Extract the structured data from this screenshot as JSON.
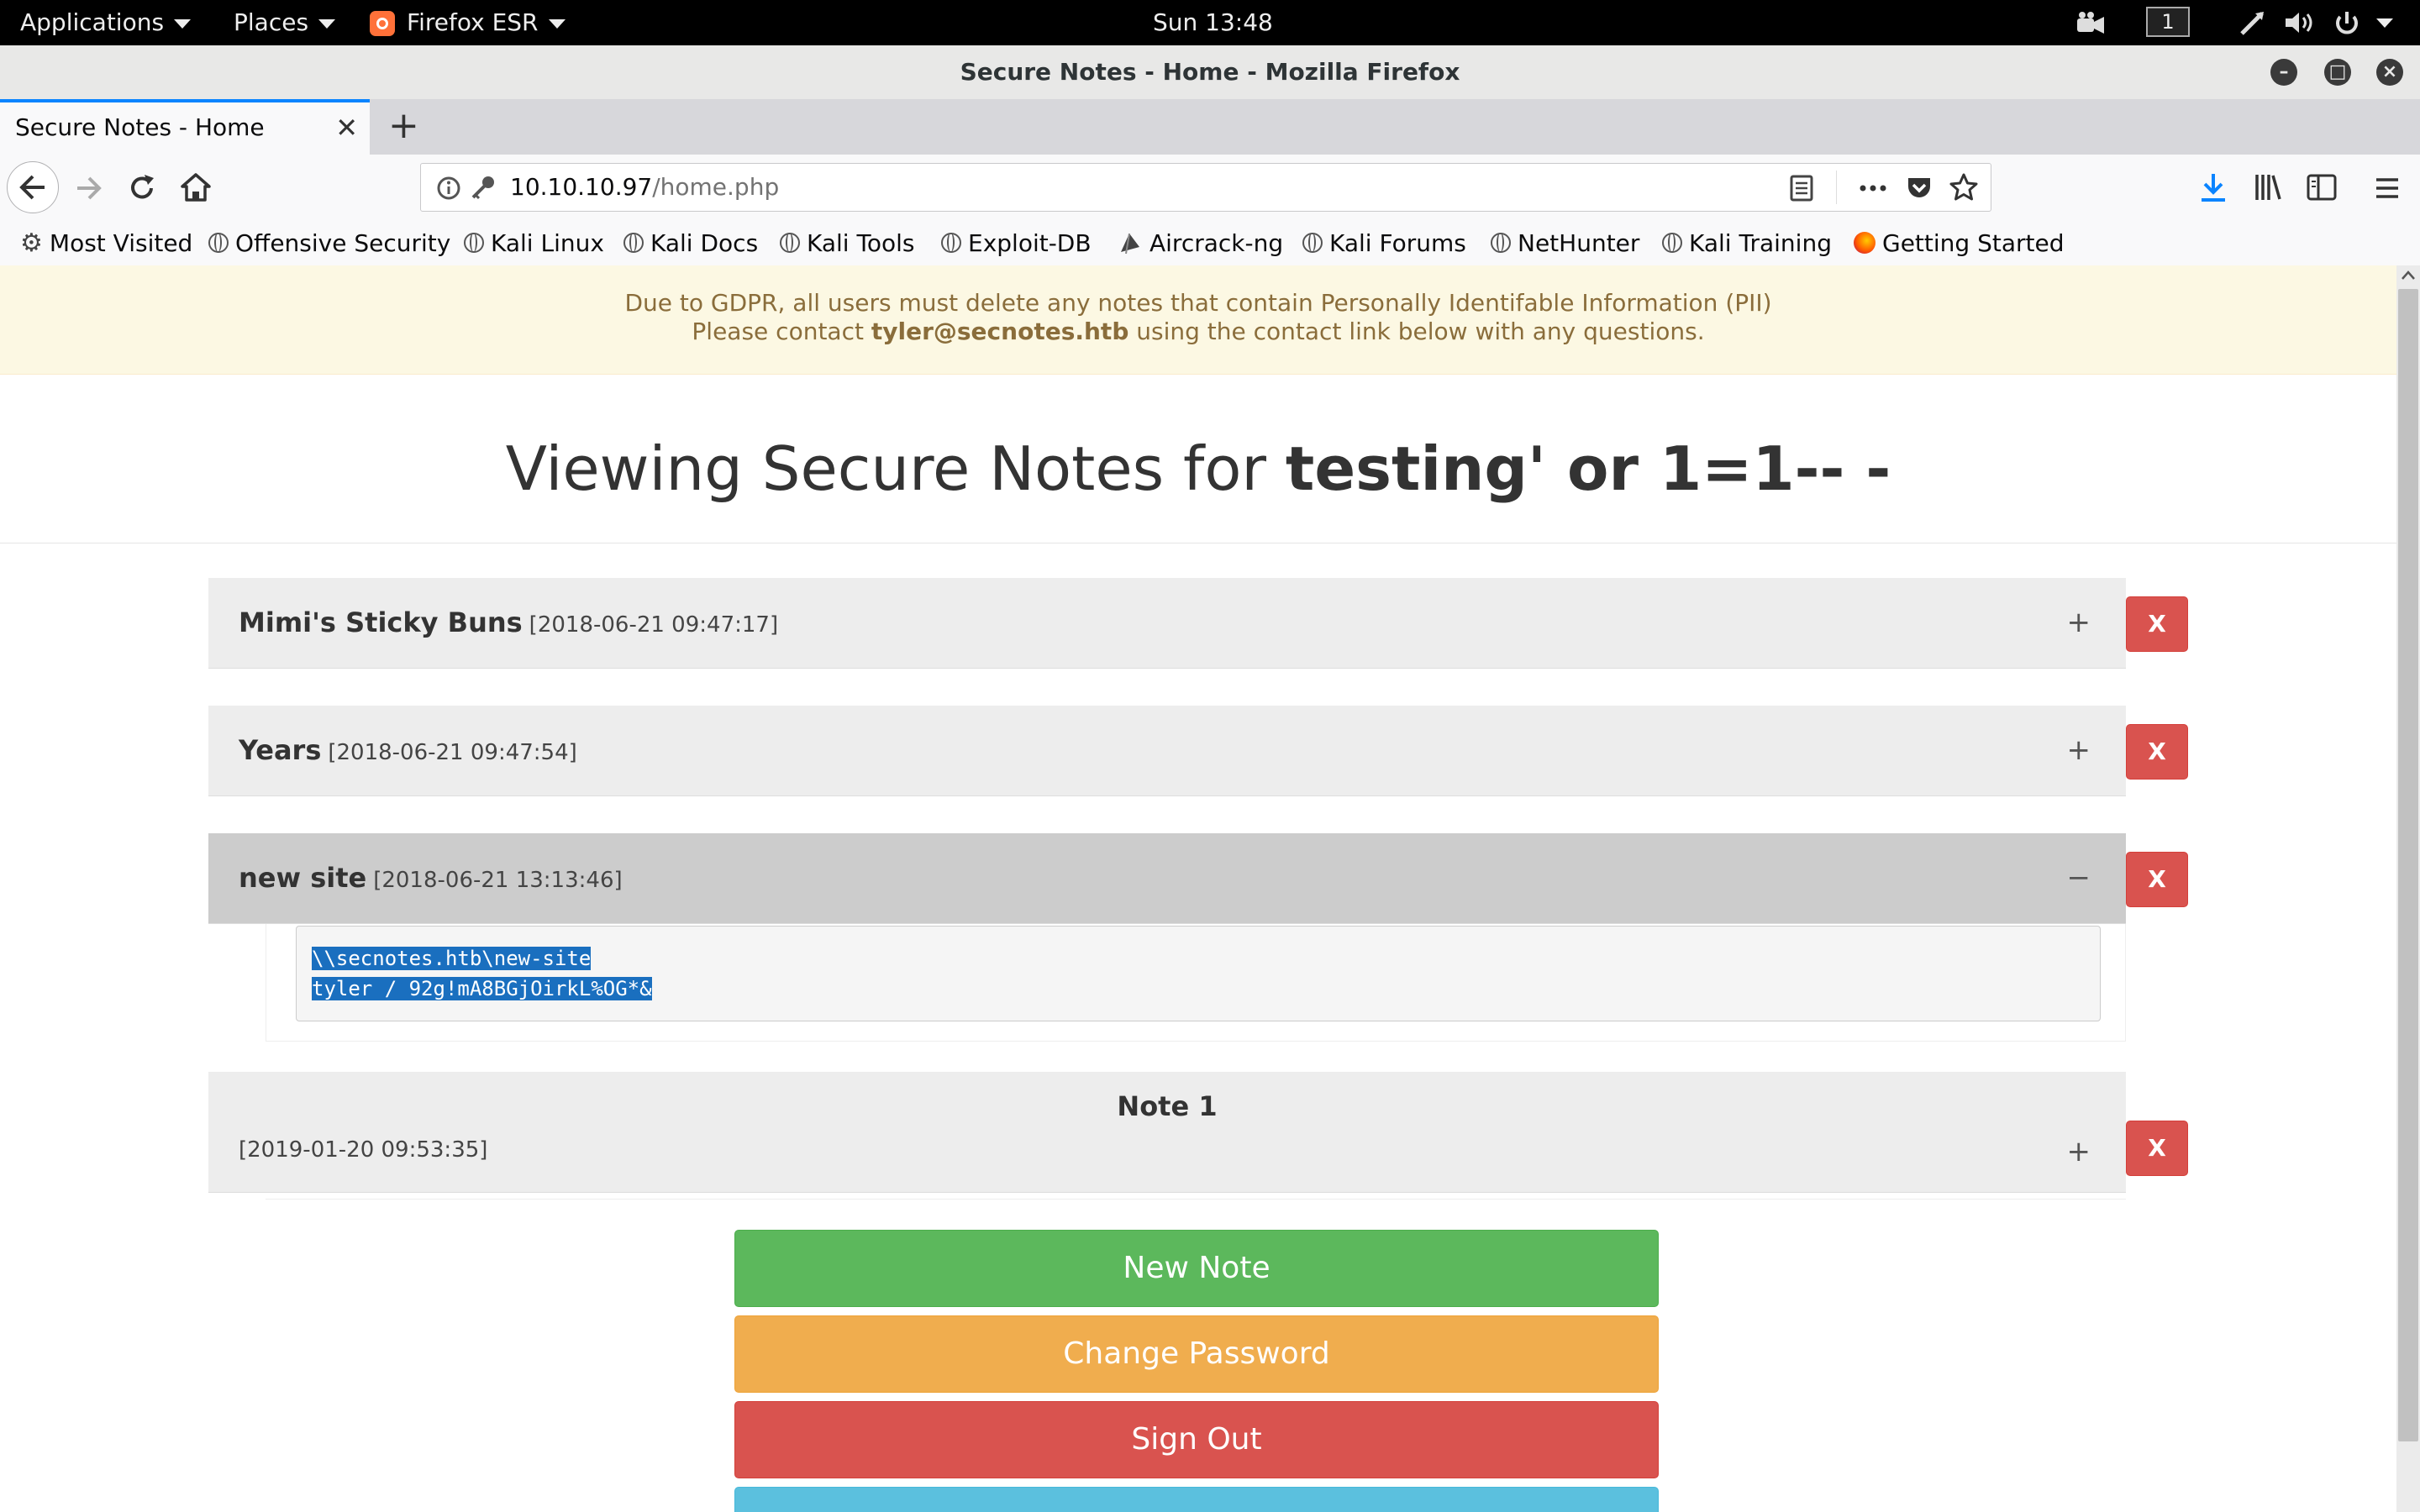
{
  "topbar": {
    "applications": "Applications",
    "places": "Places",
    "firefox": "Firefox ESR",
    "clock": "Sun 13:48",
    "workspace": "1"
  },
  "window": {
    "title": "Secure Notes - Home - Mozilla Firefox"
  },
  "tab": {
    "label": "Secure Notes - Home"
  },
  "urlbar": {
    "host": "10.10.10.97",
    "path": "/home.php"
  },
  "bookmarks": [
    "Most Visited",
    "Offensive Security",
    "Kali Linux",
    "Kali Docs",
    "Kali Tools",
    "Exploit-DB",
    "Aircrack-ng",
    "Kali Forums",
    "NetHunter",
    "Kali Training",
    "Getting Started"
  ],
  "alert": {
    "line1": "Due to GDPR, all users must delete any notes that contain Personally Identifable Information (PII)",
    "line2_pre": "Please contact ",
    "line2_email": "tyler@secnotes.htb",
    "line2_post": " using the contact link below with any questions."
  },
  "heading": {
    "prefix": "Viewing Secure Notes for ",
    "user": "testing' or 1=1-- -"
  },
  "notes": [
    {
      "title": "Mimi's Sticky Buns",
      "date": "[2018-06-21 09:47:17]",
      "toggle": "+",
      "delete": "X"
    },
    {
      "title": "Years",
      "date": "[2018-06-21 09:47:54]",
      "toggle": "+",
      "delete": "X"
    },
    {
      "title": "new site",
      "date": "[2018-06-21 13:13:46]",
      "toggle": "−",
      "delete": "X",
      "body_line1": "\\\\secnotes.htb\\new-site",
      "body_line2": "tyler / 92g!mA8BGjOirkL%OG*&"
    },
    {
      "title": "Note 1",
      "date": "[2019-01-20 09:53:35]",
      "toggle": "+",
      "delete": "X"
    }
  ],
  "buttons": {
    "new_note": "New Note",
    "change_password": "Change Password",
    "sign_out": "Sign Out"
  },
  "colors": {
    "green": "#5cb85c",
    "orange": "#f0ad4e",
    "red": "#d9534f",
    "blue": "#5bc0de"
  }
}
